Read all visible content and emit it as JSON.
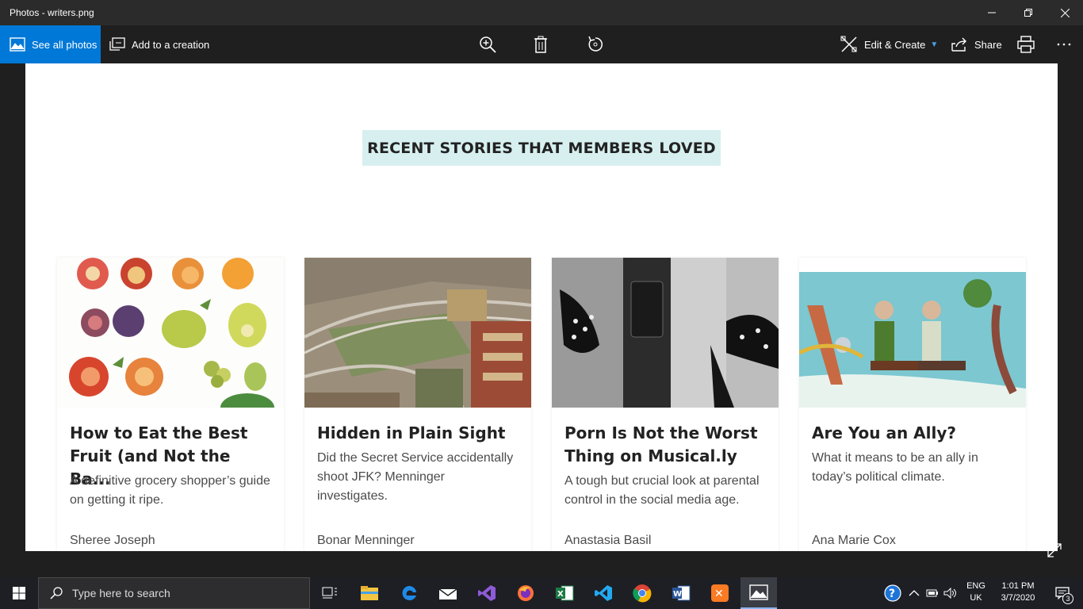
{
  "window": {
    "title": "Photos - writers.png"
  },
  "toolbar": {
    "see_all_label": "See all photos",
    "add_creation_label": "Add to a creation",
    "edit_create_label": "Edit & Create",
    "share_label": "Share",
    "icons": [
      "zoom-in-icon",
      "trash-icon",
      "rotate-icon",
      "edit-create-icon",
      "share-icon",
      "print-icon",
      "more-icon"
    ]
  },
  "photo": {
    "banner": "RECENT STORIES THAT MEMBERS LOVED",
    "cards": [
      {
        "title": "How to Eat the Best Fruit (and Not the Ba...",
        "description": "A definitive grocery shopper’s guide on getting it ripe.",
        "author": "Sheree Joseph"
      },
      {
        "title": "Hidden in Plain Sight",
        "description": "Did the Secret Service accidentally shoot JFK? Menninger investigates.",
        "author": "Bonar Menninger"
      },
      {
        "title": "Porn Is Not the Worst Thing on Musical.ly",
        "description": "A tough but crucial look at parental control in the social media age.",
        "author": "Anastasia Basil"
      },
      {
        "title": "Are You an Ally?",
        "description": "What it means to be an ally in today’s political climate.",
        "author": "Ana Marie Cox"
      }
    ]
  },
  "taskbar": {
    "search_placeholder": "Type here to search",
    "lang_line1": "ENG",
    "lang_line2": "UK",
    "time": "1:01 PM",
    "date": "3/7/2020",
    "notification_count": "3",
    "apps": [
      "task-view",
      "file-explorer",
      "edge",
      "mail",
      "visual-studio",
      "firefox",
      "excel",
      "vscode",
      "chrome",
      "word",
      "xampp",
      "photos"
    ]
  },
  "colors": {
    "accent": "#0078d7",
    "banner_bg": "#d7efef"
  }
}
